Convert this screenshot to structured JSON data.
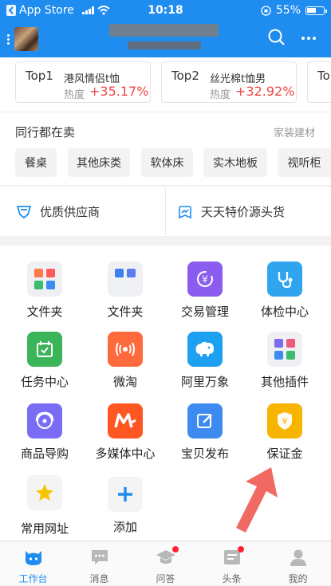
{
  "status_bar": {
    "back_app": "App Store",
    "time": "10:18",
    "battery": "55%"
  },
  "header": {
    "search_icon": "search-icon",
    "more_icon": "more-icon"
  },
  "top_products": [
    {
      "rank": "Top1",
      "name": "港风情侣t恤",
      "heat_label": "热度",
      "heat": "+35.17%"
    },
    {
      "rank": "Top2",
      "name": "丝光棉t恤男",
      "heat_label": "热度",
      "heat": "+32.92%"
    },
    {
      "rank": "To",
      "name": "",
      "heat_label": "",
      "heat": ""
    }
  ],
  "peers": {
    "title": "同行都在卖",
    "category": "家装建材",
    "chips": [
      "餐桌",
      "其他床类",
      "软体床",
      "实木地板",
      "视听柜"
    ]
  },
  "suppliers": [
    {
      "label": "优质供应商",
      "icon": "shield-icon"
    },
    {
      "label": "天天特价源头货",
      "icon": "price-tag-icon"
    }
  ],
  "tools": [
    {
      "label": "文件夹",
      "icon": "folder-icon"
    },
    {
      "label": "文件夹",
      "icon": "folder-icon"
    },
    {
      "label": "交易管理",
      "icon": "yuan-cycle-icon"
    },
    {
      "label": "体检中心",
      "icon": "stethoscope-icon"
    },
    {
      "label": "任务中心",
      "icon": "calendar-check-icon"
    },
    {
      "label": "微淘",
      "icon": "broadcast-icon"
    },
    {
      "label": "阿里万象",
      "icon": "elephant-icon"
    },
    {
      "label": "其他插件",
      "icon": "plugins-icon"
    },
    {
      "label": "商品导购",
      "icon": "headset-icon"
    },
    {
      "label": "多媒体中心",
      "icon": "media-m-icon"
    },
    {
      "label": "宝贝发布",
      "icon": "edit-icon"
    },
    {
      "label": "保证金",
      "icon": "deposit-shield-icon"
    },
    {
      "label": "常用网址",
      "icon": "star-icon"
    },
    {
      "label": "添加",
      "icon": "plus-icon"
    }
  ],
  "tabs": [
    {
      "label": "工作台",
      "icon": "workbench-icon",
      "active": true
    },
    {
      "label": "消息",
      "icon": "message-icon",
      "active": false
    },
    {
      "label": "问答",
      "icon": "qa-icon",
      "active": false
    },
    {
      "label": "头条",
      "icon": "headline-icon",
      "active": false
    },
    {
      "label": "我的",
      "icon": "profile-icon",
      "active": false
    }
  ],
  "colors": {
    "brand_blue": "#1f8cf0",
    "heat_red": "#f04848",
    "annotation_arrow": "#f0625a"
  }
}
